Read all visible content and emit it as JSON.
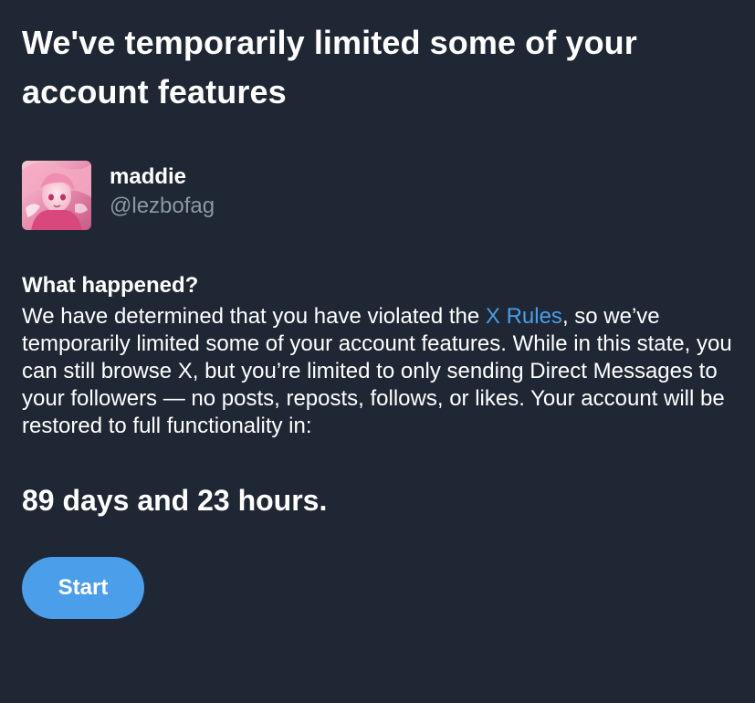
{
  "header": {
    "title": "We've temporarily limited some of your account features"
  },
  "account": {
    "display_name": "maddie",
    "handle": "@lezbofag",
    "avatar_icon": "profile-avatar"
  },
  "what_happened": {
    "heading": "What happened?",
    "text_before_link": "We have determined that you have violated the ",
    "link_label": "X Rules",
    "text_after_link": ", so we’ve temporarily limited some of your account features. While in this state, you can still browse X, but you’re limited to only sending Direct Messages to your followers — no posts, reposts, follows, or likes. Your account will be restored to full functionality in:"
  },
  "countdown": "89 days and 23 hours.",
  "actions": {
    "start_label": "Start"
  },
  "colors": {
    "background": "#1e2733",
    "accent": "#4a9eea",
    "secondary_text": "#8b98a5"
  }
}
